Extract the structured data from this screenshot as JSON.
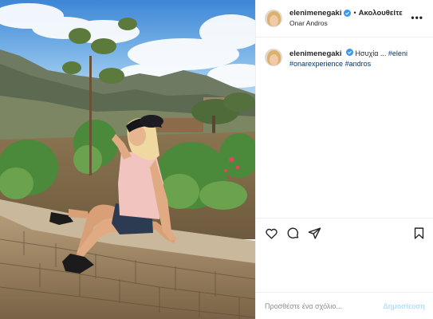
{
  "post": {
    "author": {
      "username": "elenimenegaki",
      "verified": true,
      "avatar_icon": "profile-photo"
    },
    "follow_label": "Ακολουθείτε",
    "separator": "•",
    "location": "Onar Andros",
    "more_icon": "more-options-icon",
    "more_label": "•••",
    "caption": {
      "username": "elenimenegaki",
      "text": "Ησυχία ... ",
      "hashtags": [
        "#eleni",
        "#onarexperience",
        "#andros"
      ]
    },
    "actions": {
      "like_icon": "heart-icon",
      "comment_icon": "comment-icon",
      "share_icon": "share-icon",
      "save_icon": "bookmark-icon"
    },
    "comment_box": {
      "placeholder": "Προσθέστε ένα σχόλιο...",
      "publish_label": "Δημοσίευση"
    }
  },
  "colors": {
    "verified_blue": "#3897f0",
    "hashtag_blue": "#00376b",
    "publish_disabled": "#b2dffc",
    "border": "#efefef"
  }
}
